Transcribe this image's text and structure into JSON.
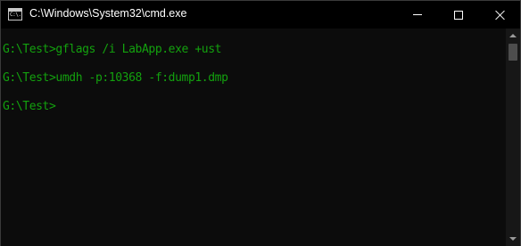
{
  "window": {
    "title": "C:\\Windows\\System32\\cmd.exe",
    "icon_label": "C:\\.",
    "controls": {
      "minimize": "minimize-icon",
      "maximize": "maximize-icon",
      "close": "close-icon"
    }
  },
  "console": {
    "text_color": "#13a10e",
    "background": "#0c0c0c",
    "lines": [
      "G:\\Test>gflags /i LabApp.exe +ust",
      "G:\\Test>umdh -p:10368 -f:dump1.dmp",
      "G:\\Test>"
    ]
  }
}
